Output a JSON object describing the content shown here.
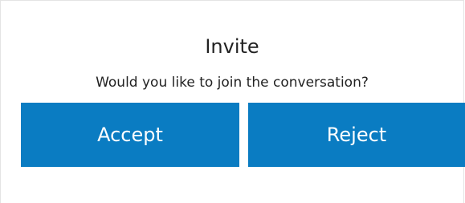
{
  "dialog": {
    "title": "Invite",
    "message": "Would you like to join the conversation?",
    "accept_label": "Accept",
    "reject_label": "Reject"
  },
  "colors": {
    "button_background": "#0a7cc2",
    "button_text": "#ffffff",
    "text": "#222222"
  }
}
